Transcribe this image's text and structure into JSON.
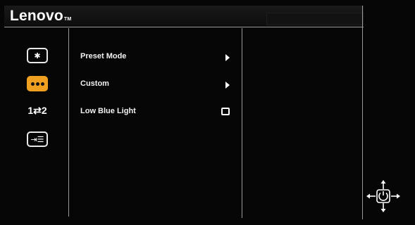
{
  "header": {
    "brand": "Lenovo",
    "trademark": "TM"
  },
  "sidebar": {
    "items": [
      {
        "icon": "brightness-contrast-icon",
        "glyph": "✱",
        "selected": false
      },
      {
        "icon": "color-settings-icon",
        "selected": true
      },
      {
        "icon": "input-source-icon",
        "glyph": "1⇄2",
        "selected": false
      },
      {
        "icon": "menu-settings-icon",
        "glyph": "⇥☰",
        "selected": false
      }
    ]
  },
  "menu": {
    "items": [
      {
        "label": "Preset Mode",
        "control": "submenu-arrow"
      },
      {
        "label": "Custom",
        "control": "submenu-arrow"
      },
      {
        "label": "Low Blue Light",
        "control": "checkbox",
        "checked": false
      }
    ]
  },
  "colors": {
    "background": "#050505",
    "accent": "#f0a020",
    "line": "#9a9a9a",
    "text": "#ffffff"
  },
  "footer": {
    "icon": "joystick-navigation-icon"
  }
}
